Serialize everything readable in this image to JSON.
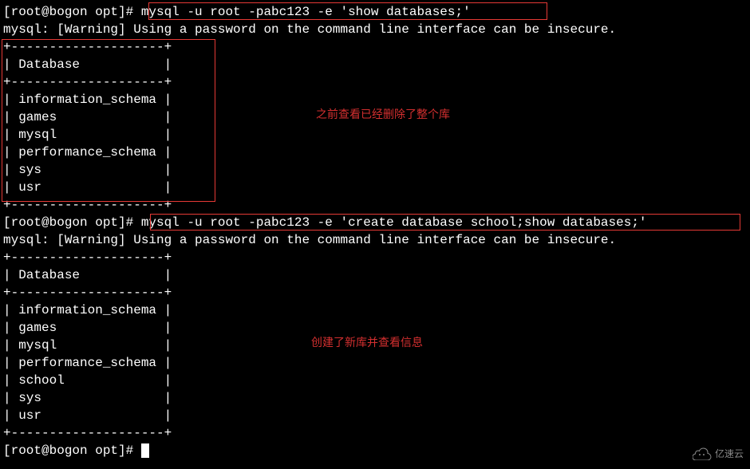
{
  "prompt": "[root@bogon opt]# ",
  "command1": "mysql -u root -pabc123 -e 'show databases;'",
  "warning": "mysql: [Warning] Using a password on the command line interface can be insecure.",
  "table_border_top": "+--------------------+",
  "table_header": "| Database           |",
  "databases1": [
    "| information_schema |",
    "| games              |",
    "| mysql              |",
    "| performance_schema |",
    "| sys                |",
    "| usr                |"
  ],
  "annotation1": "之前查看已经删除了整个库",
  "command2": "mysql -u root -pabc123 -e 'create database school;show databases;'",
  "databases2": [
    "| information_schema |",
    "| games              |",
    "| mysql              |",
    "| performance_schema |",
    "| school             |",
    "| sys                |",
    "| usr                |"
  ],
  "annotation2": "创建了新库并查看信息",
  "watermark_text": "亿速云"
}
